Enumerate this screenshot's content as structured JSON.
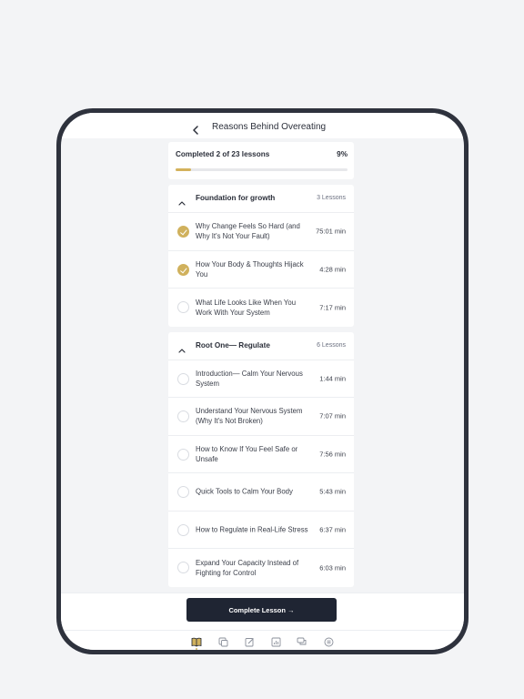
{
  "header": {
    "title": "Reasons Behind Overeating",
    "back_icon": "chevron-left-icon"
  },
  "progress": {
    "label": "Completed 2 of 23 lessons",
    "percent_label": "9%",
    "value": 0.09,
    "fill_color": "#d4b25c"
  },
  "sections": [
    {
      "title": "Foundation for growth",
      "count": "3 Lessons",
      "expanded": true,
      "lessons": [
        {
          "title": "Why Change Feels So Hard (and Why It's Not Your Fault)",
          "duration": "75:01 min",
          "completed": true
        },
        {
          "title": "How Your Body & Thoughts Hijack You",
          "duration": "4:28 min",
          "completed": true
        },
        {
          "title": "What Life Looks Like When You Work With Your System",
          "duration": "7:17 min",
          "completed": false
        }
      ]
    },
    {
      "title": "Root One— Regulate",
      "count": "6 Lessons",
      "expanded": true,
      "lessons": [
        {
          "title": "Introduction— Calm Your Nervous System",
          "duration": "1:44 min",
          "completed": false
        },
        {
          "title": "Understand Your Nervous System (Why It's Not Broken)",
          "duration": "7:07 min",
          "completed": false
        },
        {
          "title": "How to Know If You Feel Safe or Unsafe",
          "duration": "7:56 min",
          "completed": false
        },
        {
          "title": "Quick Tools to Calm Your Body",
          "duration": "5:43 min",
          "completed": false
        },
        {
          "title": "How to Regulate in Real-Life Stress",
          "duration": "6:37 min",
          "completed": false
        },
        {
          "title": "Expand Your Capacity Instead of Fighting for Control",
          "duration": "6:03 min",
          "completed": false
        }
      ]
    }
  ],
  "actions": {
    "complete_label": "Complete Lesson →"
  },
  "tabbar": {
    "items": [
      {
        "icon": "book-open-icon",
        "active": true
      },
      {
        "icon": "copy-icon",
        "active": false
      },
      {
        "icon": "edit-icon",
        "active": false
      },
      {
        "icon": "chart-icon",
        "active": false
      },
      {
        "icon": "chat-icon",
        "active": false
      },
      {
        "icon": "menu-circle-icon",
        "active": false
      }
    ]
  },
  "colors": {
    "accent": "#d0b15d",
    "dark": "#1f2533",
    "device_frame": "#2e323d"
  }
}
